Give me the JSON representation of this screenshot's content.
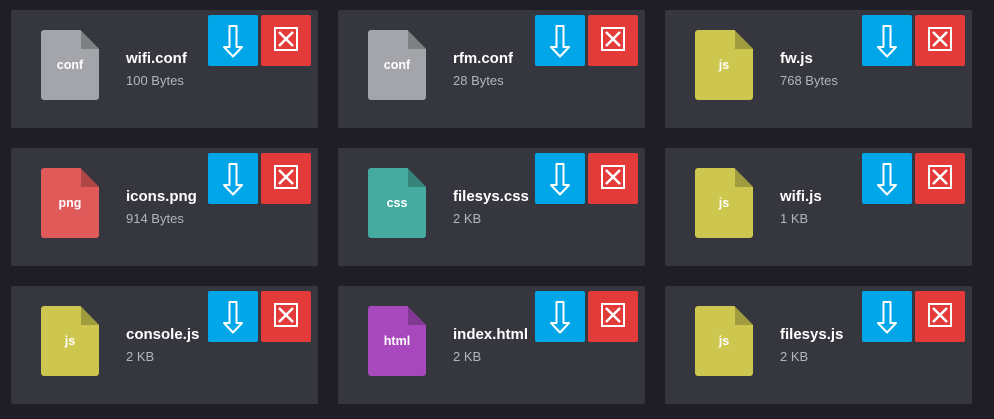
{
  "colors": {
    "background": "#1f1e26",
    "card": "#36363f",
    "download_button": "#00a6e8",
    "delete_button": "#e33a3a",
    "conf_icon": "#a3a5aa",
    "js_icon": "#cec74f",
    "png_icon": "#e05a5a",
    "css_icon": "#45aba0",
    "html_icon": "#a749bd",
    "size_text": "#b4b4bc"
  },
  "icons": {
    "download": "arrow-down-icon",
    "delete": "close-box-icon"
  },
  "files": [
    {
      "name": "wifi.conf",
      "size": "100 Bytes",
      "ext": "conf",
      "color": "#a3a5aa"
    },
    {
      "name": "rfm.conf",
      "size": "28 Bytes",
      "ext": "conf",
      "color": "#a3a5aa"
    },
    {
      "name": "fw.js",
      "size": "768 Bytes",
      "ext": "js",
      "color": "#cec74f"
    },
    {
      "name": "icons.png",
      "size": "914 Bytes",
      "ext": "png",
      "color": "#e05a5a"
    },
    {
      "name": "filesys.css",
      "size": "2 KB",
      "ext": "css",
      "color": "#45aba0"
    },
    {
      "name": "wifi.js",
      "size": "1 KB",
      "ext": "js",
      "color": "#cec74f"
    },
    {
      "name": "console.js",
      "size": "2 KB",
      "ext": "js",
      "color": "#cec74f"
    },
    {
      "name": "index.html",
      "size": "2 KB",
      "ext": "html",
      "color": "#a749bd"
    },
    {
      "name": "filesys.js",
      "size": "2 KB",
      "ext": "js",
      "color": "#cec74f"
    }
  ]
}
